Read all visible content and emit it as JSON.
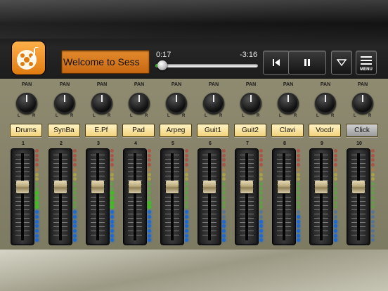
{
  "song": {
    "title": "Welcome to Sess"
  },
  "transport": {
    "elapsed": "0:17",
    "remaining": "-3:16",
    "progress_fraction": 0.05,
    "menu_label": "MENU"
  },
  "mixer": {
    "pan_label": "PAN",
    "left_label": "L",
    "right_label": "R",
    "channels": [
      {
        "number": "1",
        "name": "Drums",
        "fader": 0.62,
        "level": 0.55,
        "active": true
      },
      {
        "number": "2",
        "name": "SynBa",
        "fader": 0.62,
        "level": 0.35,
        "active": true
      },
      {
        "number": "3",
        "name": "E.Pf",
        "fader": 0.62,
        "level": 0.55,
        "active": true
      },
      {
        "number": "4",
        "name": "Pad",
        "fader": 0.62,
        "level": 0.45,
        "active": true
      },
      {
        "number": "5",
        "name": "Arpeg",
        "fader": 0.62,
        "level": 0.35,
        "active": true
      },
      {
        "number": "6",
        "name": "Guit1",
        "fader": 0.62,
        "level": 0.25,
        "active": true
      },
      {
        "number": "7",
        "name": "Guit2",
        "fader": 0.62,
        "level": 0.25,
        "active": true
      },
      {
        "number": "8",
        "name": "Clavi",
        "fader": 0.62,
        "level": 0.3,
        "active": true
      },
      {
        "number": "9",
        "name": "Vocdr",
        "fader": 0.62,
        "level": 0.25,
        "active": true
      },
      {
        "number": "10",
        "name": "Click",
        "fader": 0.62,
        "level": 0.0,
        "active": false
      }
    ]
  },
  "colors": {
    "accent": "#e38a2c",
    "progress": "#3cc021",
    "label_bg": "#f1d27c"
  }
}
